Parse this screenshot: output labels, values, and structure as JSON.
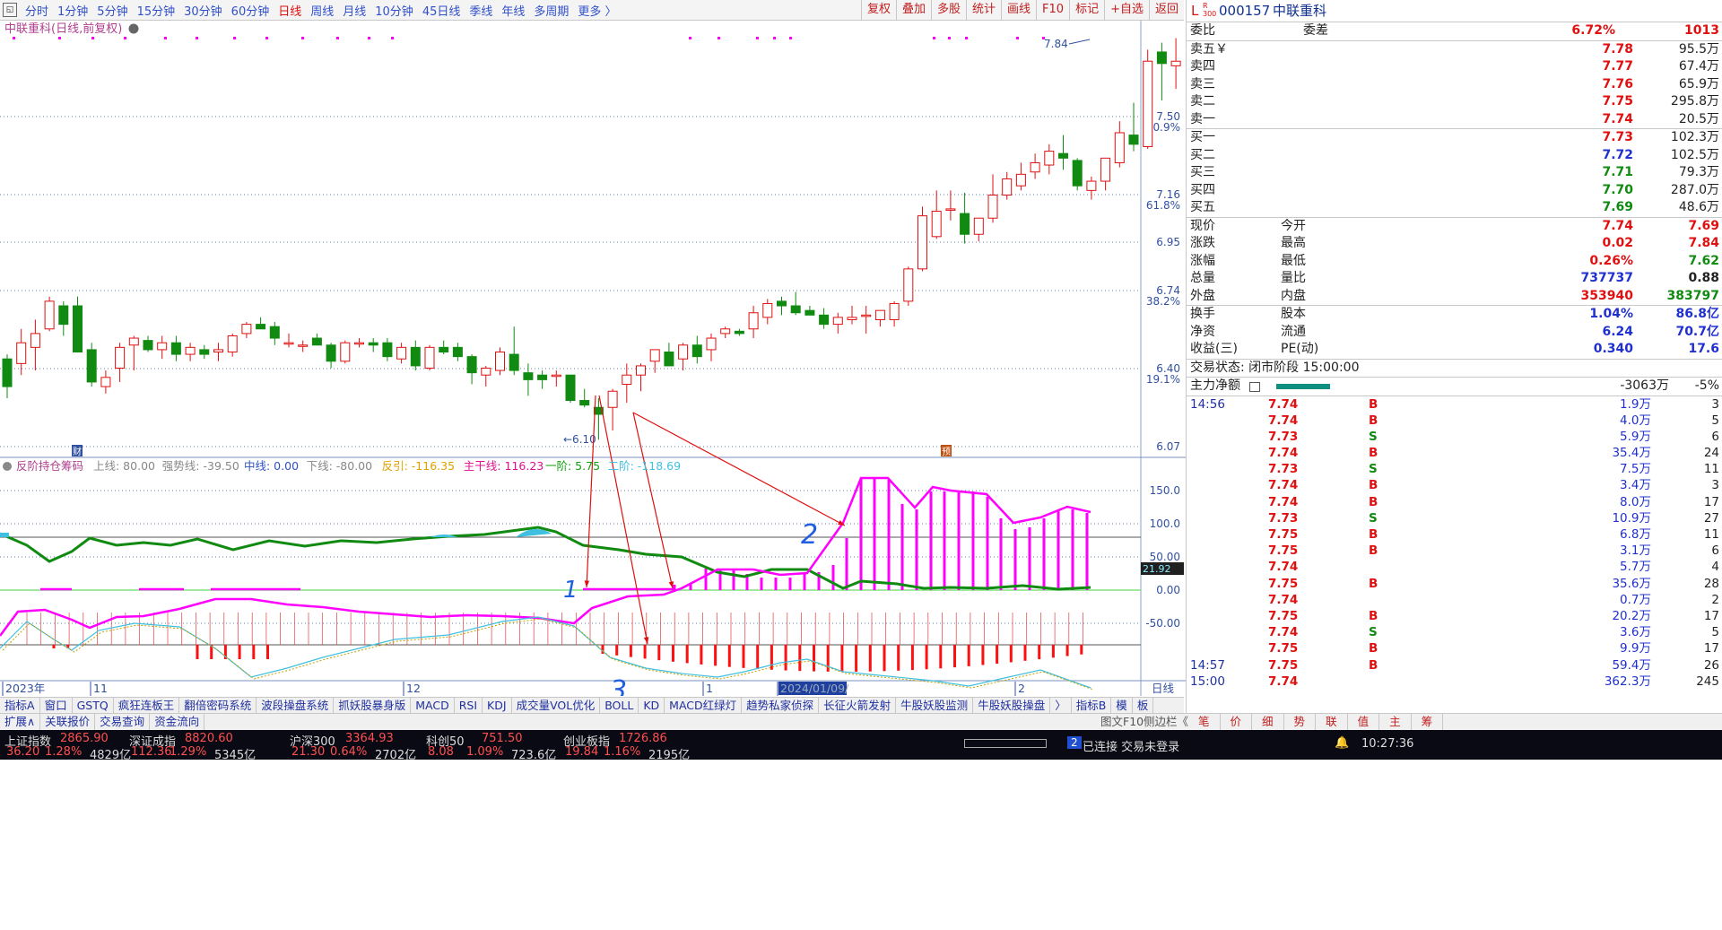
{
  "toolbar": {
    "periods": [
      "分时",
      "1分钟",
      "5分钟",
      "15分钟",
      "30分钟",
      "60分钟",
      "日线",
      "周线",
      "月线",
      "10分钟",
      "45日线",
      "季线",
      "年线",
      "多周期",
      "更多 〉"
    ],
    "active_period": "日线",
    "tools": [
      "复权",
      "叠加",
      "多股",
      "统计",
      "画线",
      "F10",
      "标记",
      "+自选",
      "返回"
    ]
  },
  "chart": {
    "title": "中联重科(日线,前复权)",
    "price_labels": [
      "7.50",
      "7.16",
      "6.95",
      "6.74",
      "6.40",
      "6.07"
    ],
    "pct_labels": [
      "80.9%",
      "61.8%",
      "38.2%",
      "19.1%"
    ],
    "high_marker": "7.84",
    "low_marker": "6.10",
    "indicator_header": {
      "name": "反阶持仓筹码",
      "items": [
        "上线: 80.00",
        "强势线: -39.50",
        "中线: 0.00",
        "下线: -80.00",
        "反引: -116.35",
        "主干线: 116.23",
        "一阶: 5.75",
        "二阶: -118.69"
      ]
    },
    "indicator_labels": [
      "150.0",
      "100.0",
      "50.00",
      "0.00",
      "-50.00"
    ],
    "current_value_tag": "21.92",
    "x_labels": [
      "2023年",
      "11",
      "12",
      "1",
      "2024/01/09/",
      "2"
    ],
    "period_label": "日线",
    "annotations": [
      "1",
      "2",
      "3"
    ],
    "events": [
      "财",
      "预"
    ]
  },
  "indicator_tabs": [
    "指标A",
    "窗口",
    "GSTQ",
    "疯狂连板王",
    "翻倍密码系统",
    "波段操盘系统",
    "抓妖股暴身版",
    "MACD",
    "RSI",
    "KDJ",
    "成交量VOL优化",
    "BOLL",
    "KD",
    "MACD红绿灯",
    "趋势私家侦探",
    "长征火箭发射",
    "牛股妖股监测",
    "牛股妖股操盘",
    "〉",
    "指标B",
    "模",
    "板"
  ],
  "bottom_tabs": [
    "扩展∧",
    "关联报价",
    "交易查询",
    "资金流向"
  ],
  "right_bottom_tabs": [
    "笔",
    "价",
    "细",
    "势",
    "联",
    "值",
    "主",
    "筹"
  ],
  "right_bottom_labels": {
    "left": "图文F10",
    "right": "侧边栏《"
  },
  "quote": {
    "code": "000157",
    "name": "中联重科",
    "badge": "R 300",
    "weibi_label": "委比",
    "weibi": "6.72%",
    "weicha_label": "委差",
    "weicha": "1013",
    "sell": [
      {
        "label": "卖五￥",
        "price": "7.78",
        "vol": "95.5万"
      },
      {
        "label": "卖四",
        "price": "7.77",
        "vol": "67.4万"
      },
      {
        "label": "卖三",
        "price": "7.76",
        "vol": "65.9万"
      },
      {
        "label": "卖二",
        "price": "7.75",
        "vol": "295.8万"
      },
      {
        "label": "卖一",
        "price": "7.74",
        "vol": "20.5万"
      }
    ],
    "buy": [
      {
        "label": "买一",
        "price": "7.73",
        "vol": "102.3万"
      },
      {
        "label": "买二",
        "price": "7.72",
        "vol": "102.5万"
      },
      {
        "label": "买三",
        "price": "7.71",
        "vol": "79.3万"
      },
      {
        "label": "买四",
        "price": "7.70",
        "vol": "287.0万"
      },
      {
        "label": "买五",
        "price": "7.69",
        "vol": "48.6万"
      }
    ],
    "stats": [
      {
        "l": "现价",
        "v": "7.74",
        "l2": "今开",
        "v2": "7.69"
      },
      {
        "l": "涨跌",
        "v": "0.02",
        "l2": "最高",
        "v2": "7.84"
      },
      {
        "l": "涨幅",
        "v": "0.26%",
        "l2": "最低",
        "v2": "7.62"
      },
      {
        "l": "总量",
        "v": "737737",
        "l2": "量比",
        "v2": "0.88"
      },
      {
        "l": "外盘",
        "v": "353940",
        "l2": "内盘",
        "v2": "383797"
      }
    ],
    "stats2": [
      {
        "l": "换手",
        "v": "1.04%",
        "l2": "股本",
        "v2": "86.8亿"
      },
      {
        "l": "净资",
        "v": "6.24",
        "l2": "流通",
        "v2": "70.7亿"
      },
      {
        "l": "收益(三)",
        "v": "0.340",
        "l2": "PE(动)",
        "v2": "17.6"
      }
    ],
    "trade_status": "交易状态: 闭市阶段 15:00:00",
    "main_net_label": "主力净额",
    "main_net": "-3063万",
    "main_net_pct": "-5%",
    "ticks": [
      {
        "t": "14:56",
        "p": "7.74",
        "v": "1.9万",
        "d": "B",
        "n": "3"
      },
      {
        "t": "",
        "p": "7.74",
        "v": "4.0万",
        "d": "B",
        "n": "5"
      },
      {
        "t": "",
        "p": "7.73",
        "v": "5.9万",
        "d": "S",
        "n": "6"
      },
      {
        "t": "",
        "p": "7.74",
        "v": "35.4万",
        "d": "B",
        "n": "24"
      },
      {
        "t": "",
        "p": "7.73",
        "v": "7.5万",
        "d": "S",
        "n": "11"
      },
      {
        "t": "",
        "p": "7.74",
        "v": "3.4万",
        "d": "B",
        "n": "3"
      },
      {
        "t": "",
        "p": "7.74",
        "v": "8.0万",
        "d": "B",
        "n": "17"
      },
      {
        "t": "",
        "p": "7.73",
        "v": "10.9万",
        "d": "S",
        "n": "27"
      },
      {
        "t": "",
        "p": "7.75",
        "v": "6.8万",
        "d": "B",
        "n": "11"
      },
      {
        "t": "",
        "p": "7.75",
        "v": "3.1万",
        "d": "B",
        "n": "6"
      },
      {
        "t": "",
        "p": "7.74",
        "v": "5.7万",
        "d": "",
        "n": "4"
      },
      {
        "t": "",
        "p": "7.75",
        "v": "35.6万",
        "d": "B",
        "n": "28"
      },
      {
        "t": "",
        "p": "7.74",
        "v": "0.7万",
        "d": "",
        "n": "2"
      },
      {
        "t": "",
        "p": "7.75",
        "v": "20.2万",
        "d": "B",
        "n": "17"
      },
      {
        "t": "",
        "p": "7.74",
        "v": "3.6万",
        "d": "S",
        "n": "5"
      },
      {
        "t": "",
        "p": "7.75",
        "v": "9.9万",
        "d": "B",
        "n": "17"
      },
      {
        "t": "14:57",
        "p": "7.75",
        "v": "59.4万",
        "d": "B",
        "n": "26"
      },
      {
        "t": "15:00",
        "p": "7.74",
        "v": "362.3万",
        "d": "",
        "n": "245"
      }
    ]
  },
  "status": {
    "indices": [
      {
        "name": "上证指数",
        "value": "2865.90",
        "chg": "36.20",
        "pct": "1.28%",
        "amt": "4829亿"
      },
      {
        "name": "深证成指",
        "value": "8820.60",
        "chg": "112.36",
        "pct": "1.29%",
        "amt": "5345亿"
      },
      {
        "name": "沪深300",
        "value": "3364.93",
        "chg": "21.30",
        "pct": "0.64%",
        "amt": "2702亿"
      },
      {
        "name": "科创50",
        "value": "751.50",
        "chg": "8.08",
        "pct": "1.09%",
        "amt": "723.6亿"
      },
      {
        "name": "创业板指",
        "value": "1726.86",
        "chg": "19.84",
        "pct": "1.16%",
        "amt": "2195亿"
      }
    ],
    "conn_badge": "2",
    "conn_text": "已连接 交易未登录",
    "clock": "10:27:36"
  },
  "colors": {
    "up": "#e01010",
    "down": "#108a10",
    "magenta": "#ff00ff",
    "bg": "#ffffff"
  }
}
